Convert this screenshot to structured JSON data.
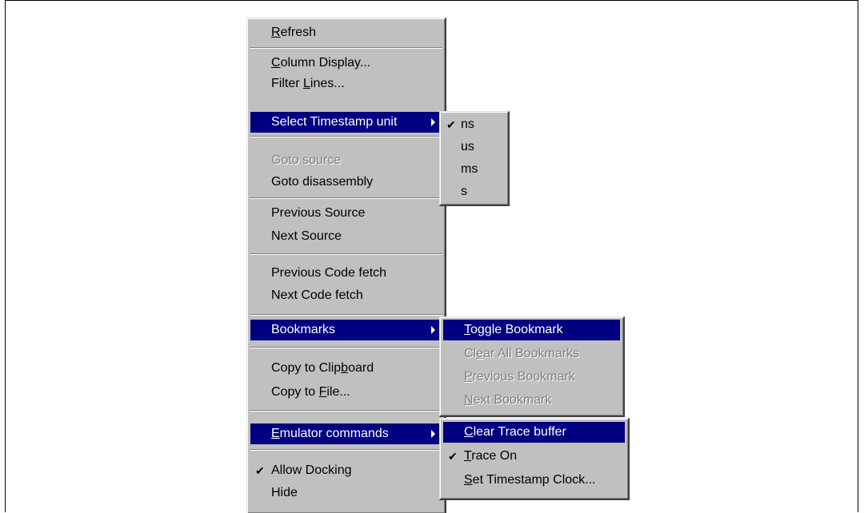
{
  "main_menu": {
    "refresh": {
      "pre": "",
      "u": "R",
      "post": "efresh"
    },
    "column_display": {
      "pre": "",
      "u": "C",
      "post": "olumn Display..."
    },
    "filter_lines": {
      "pre": "Filter ",
      "u": "L",
      "post": "ines..."
    },
    "select_timestamp": "Select Timestamp unit",
    "goto_source": "Goto source",
    "goto_disassembly": "Goto disassembly",
    "previous_source": "Previous Source",
    "next_source": "Next Source",
    "previous_code_fetch": "Previous Code fetch",
    "next_code_fetch": "Next Code fetch",
    "bookmarks": "Bookmarks",
    "copy_clipboard": {
      "pre": "Copy to Clip",
      "u": "b",
      "post": "oard"
    },
    "copy_file": {
      "pre": "Copy to ",
      "u": "F",
      "post": "ile..."
    },
    "emulator_commands": {
      "pre": "",
      "u": "E",
      "post": "mulator commands"
    },
    "allow_docking": "Allow Docking",
    "hide": "Hide"
  },
  "timestamp_menu": {
    "items": [
      "ns",
      "us",
      "ms",
      "s"
    ],
    "selected": "ns"
  },
  "bookmarks_menu": {
    "toggle": {
      "pre": "",
      "u": "T",
      "post": "oggle Bookmark"
    },
    "clear_all": {
      "pre": "Cl",
      "u": "e",
      "post": "ar All Bookmarks"
    },
    "previous": {
      "pre": "",
      "u": "P",
      "post": "revious Bookmark"
    },
    "next": {
      "pre": "",
      "u": "N",
      "post": "ext Bookmark"
    }
  },
  "emulator_menu": {
    "clear_trace": {
      "pre": "",
      "u": "C",
      "post": "lear Trace buffer"
    },
    "trace_on": {
      "pre": "",
      "u": "T",
      "post": "race On"
    },
    "set_clock": {
      "pre": "",
      "u": "S",
      "post": "et Timestamp Clock..."
    }
  },
  "check_mark": "✔"
}
